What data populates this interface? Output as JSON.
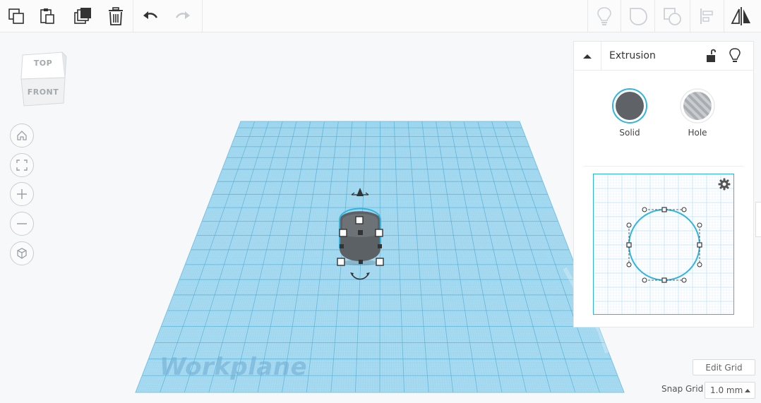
{
  "toolbar": {
    "left_tools": [
      {
        "name": "copy-icon"
      },
      {
        "name": "paste-icon"
      },
      {
        "name": "duplicate-icon"
      },
      {
        "name": "trash-icon"
      },
      {
        "name": "undo-icon"
      },
      {
        "name": "redo-icon"
      }
    ],
    "right_tools": [
      {
        "name": "lightbulb-icon"
      },
      {
        "name": "group-icon"
      },
      {
        "name": "ungroup-icon"
      },
      {
        "name": "align-icon"
      },
      {
        "name": "mirror-icon"
      }
    ]
  },
  "view_cube": {
    "top_label": "TOP",
    "front_label": "FRONT"
  },
  "nav_controls": [
    "home-icon",
    "fit-view-icon",
    "zoom-in-icon",
    "zoom-out-icon",
    "perspective-icon"
  ],
  "workplane": {
    "label": "Workplane",
    "color": "#8fd0ec",
    "grid_color": "#5fb3d6"
  },
  "inspector": {
    "title": "Extrusion",
    "solid_label": "Solid",
    "hole_label": "Hole",
    "solid_color": "#5f6368",
    "accent_color": "#2fb5e0"
  },
  "grid_controls": {
    "edit_grid_label": "Edit Grid",
    "snap_grid_label": "Snap Grid",
    "snap_grid_value": "1.0 mm"
  }
}
